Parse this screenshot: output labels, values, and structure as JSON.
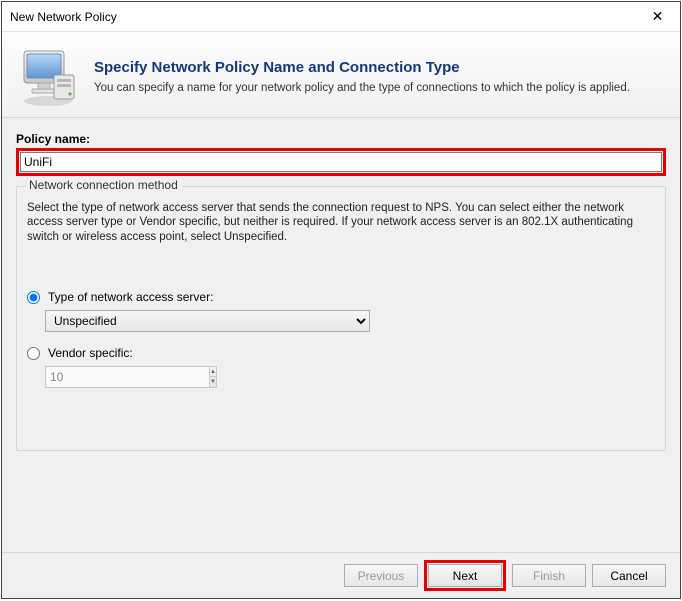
{
  "window": {
    "title": "New Network Policy",
    "close_glyph": "✕"
  },
  "header": {
    "heading": "Specify Network Policy Name and Connection Type",
    "subtext": "You can specify a name for your network policy and the type of connections to which the policy is applied."
  },
  "policy": {
    "label": "Policy name:",
    "value": "UniFi"
  },
  "group": {
    "legend": "Network connection method",
    "description": "Select the type of network access server that sends the connection request to NPS. You can select either the network access server type or Vendor specific, but neither is required. If your network access server is an 802.1X authenticating switch or wireless access point, select Unspecified.",
    "radio_type_label": "Type of network access server:",
    "select_value": "Unspecified",
    "radio_vendor_label": "Vendor specific:",
    "vendor_value": "10"
  },
  "footer": {
    "previous": "Previous",
    "next": "Next",
    "finish": "Finish",
    "cancel": "Cancel"
  }
}
